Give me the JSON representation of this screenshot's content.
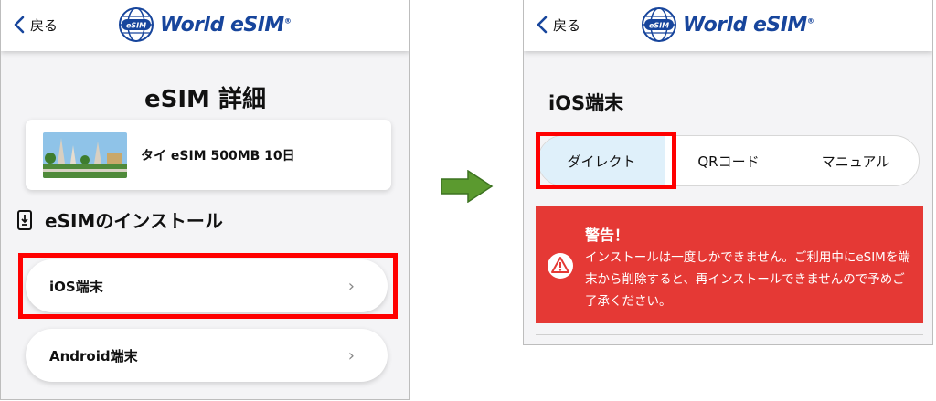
{
  "colors": {
    "brand": "#17459c",
    "highlight": "#ff0000",
    "warning_bg": "#e53935",
    "active_tab": "#dff0fa",
    "arrow": "#5b9a2f"
  },
  "header": {
    "back_label": "戻る",
    "logo_text": "World eSIM",
    "logo_badge": "eSIM",
    "logo_mark": "®"
  },
  "left": {
    "page_title": "eSIM 詳細",
    "product": {
      "name": "タイ eSIM 500MB 10日",
      "thumbnail": "temple-photo"
    },
    "section_title": "eSIMのインストール",
    "section_icon": "download-device-icon",
    "items": [
      {
        "label": "iOS端末",
        "chevron": "›"
      },
      {
        "label": "Android端末",
        "chevron": "›"
      }
    ]
  },
  "right": {
    "title": "iOS端末",
    "tabs": [
      {
        "label": "ダイレクト",
        "active": true
      },
      {
        "label": "QRコード",
        "active": false
      },
      {
        "label": "マニュアル",
        "active": false
      }
    ],
    "warning": {
      "title": "警告！",
      "body": "インストールは一度しかできません。ご利用中にeSIMを端末から削除すると、再インストールできませんので予めご了承ください。"
    }
  }
}
